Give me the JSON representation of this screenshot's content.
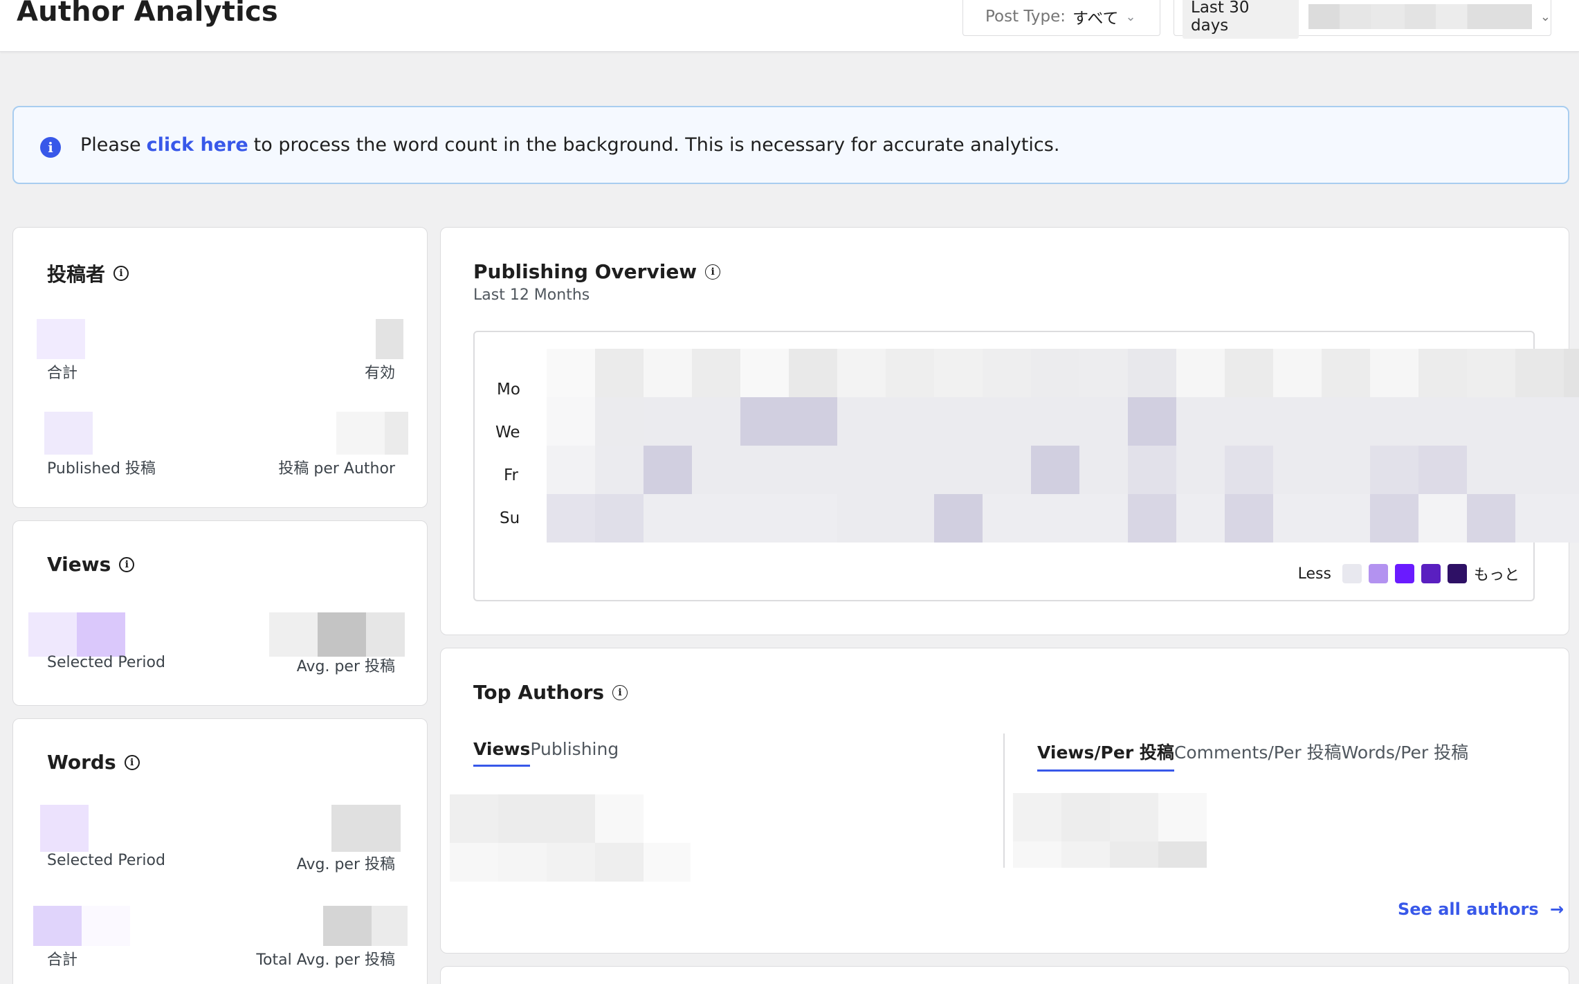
{
  "header": {
    "title": "Author Analytics",
    "post_type_label": "Post Type:",
    "post_type_value": "すべて",
    "date_range_label": "Last 30 days"
  },
  "notice": {
    "prefix": "Please",
    "link_text": "click here",
    "suffix": "to process the word count in the background. This is necessary for accurate analytics."
  },
  "authors_card": {
    "title": "投稿者",
    "labels": [
      "合計",
      "有効",
      "Published 投稿",
      "投稿 per Author"
    ]
  },
  "views_card": {
    "title": "Views",
    "labels": [
      "Selected Period",
      "Avg. per 投稿"
    ]
  },
  "words_card": {
    "title": "Words",
    "labels": [
      "Selected Period",
      "Avg. per 投稿",
      "合計",
      "Total Avg. per 投稿"
    ]
  },
  "publishing_overview": {
    "title": "Publishing Overview",
    "subtitle": "Last 12 Months",
    "day_labels": [
      "Mo",
      "We",
      "Fr",
      "Su"
    ],
    "legend_less": "Less",
    "legend_more": "もっと",
    "legend_colors": [
      "#e8e8ef",
      "#b392f0",
      "#6a1bff",
      "#5a1fc0",
      "#2e1065"
    ],
    "cell_colors": [
      [
        "#f9f9f9",
        "#ebebeb",
        "#f6f6f6",
        "#ececec",
        "#f8f8f8",
        "#e9e9e9",
        "#f3f3f3",
        "#eeeeee",
        "#f1f1f1",
        "#eeeeef",
        "#ececee",
        "#ededef",
        "#e8e8ec",
        "#f6f6f6",
        "#ebebeb",
        "#f6f6f6",
        "#ececec",
        "#f6f6f6",
        "#ececec",
        "#eeeeee",
        "#e8e8e8",
        "#e3e3e3"
      ],
      [
        "#f7f7f8",
        "#ebebee",
        "#ebebef",
        "#ebebef",
        "#d1cfe0",
        "#d1cfe0",
        "#ebebef",
        "#ebebef",
        "#ebebef",
        "#ebebef",
        "#ebebef",
        "#ebebef",
        "#d1cfe0",
        "#ebebef",
        "#ebebef",
        "#ebebef",
        "#ebebef",
        "#ebebef",
        "#ebebef",
        "#ebebef",
        "#ebebef",
        "#ebebef"
      ],
      [
        "#f2f2f4",
        "#ebebef",
        "#d1cfe0",
        "#ebebef",
        "#ebebef",
        "#ebebef",
        "#ebebef",
        "#ebebef",
        "#ebebef",
        "#ebebef",
        "#d1cfe0",
        "#ebebef",
        "#e2e1ea",
        "#ebebef",
        "#e2e1ea",
        "#ebebef",
        "#ebebef",
        "#e2e1ea",
        "#dddbe7",
        "#ebebef",
        "#ebebef",
        "#ebebef"
      ],
      [
        "#e4e3ec",
        "#e0dfe9",
        "#ededf1",
        "#ededf1",
        "#ededf1",
        "#ededf1",
        "#ebebef",
        "#ebebef",
        "#d1cfe0",
        "#ededf1",
        "#ededf1",
        "#ededf1",
        "#d8d6e4",
        "#ededf1",
        "#d8d6e4",
        "#ededf1",
        "#ededf1",
        "#d8d6e4",
        "#f3f3f5",
        "#d8d6e4",
        "#ededf1",
        "#ededf1"
      ]
    ]
  },
  "top_authors": {
    "title": "Top Authors",
    "left_tabs": [
      "Views",
      "Publishing"
    ],
    "right_tabs": [
      "Views/Per 投稿",
      "Comments/Per 投稿",
      "Words/Per 投稿"
    ],
    "see_all": "See all authors"
  }
}
